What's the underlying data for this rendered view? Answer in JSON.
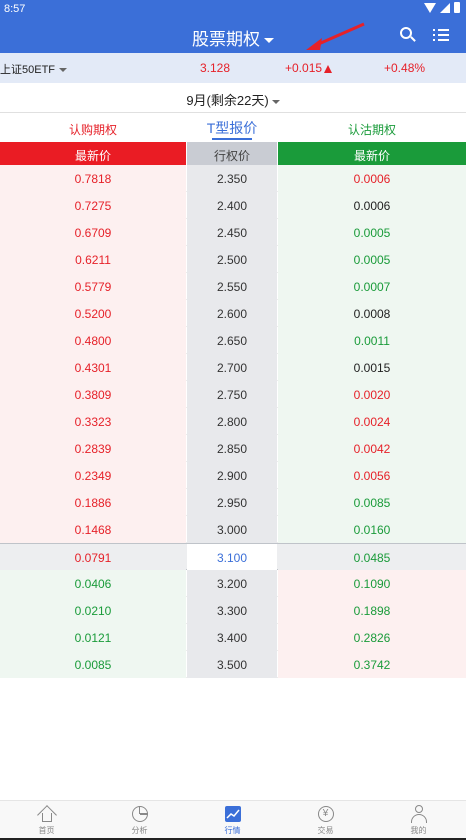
{
  "status_bar": {
    "time": "8:57"
  },
  "header": {
    "title": "股票期权"
  },
  "quote": {
    "symbol": "上证50ETF",
    "price": "3.128",
    "change": "+0.015",
    "change_pct": "+0.48%"
  },
  "expiry": {
    "label": "9月(剩余22天)"
  },
  "tabs": {
    "call": "认购期权",
    "t_quote": "T型报价",
    "put": "认沽期权"
  },
  "columns": {
    "call_last": "最新价",
    "strike": "行权价",
    "put_last": "最新价"
  },
  "rows": [
    {
      "call": "0.7818",
      "strike": "2.350",
      "put": "0.0006",
      "put_color": "red"
    },
    {
      "call": "0.7275",
      "strike": "2.400",
      "put": "0.0006",
      "put_color": "black"
    },
    {
      "call": "0.6709",
      "strike": "2.450",
      "put": "0.0005",
      "put_color": "green"
    },
    {
      "call": "0.6211",
      "strike": "2.500",
      "put": "0.0005",
      "put_color": "green"
    },
    {
      "call": "0.5779",
      "strike": "2.550",
      "put": "0.0007",
      "put_color": "green"
    },
    {
      "call": "0.5200",
      "strike": "2.600",
      "put": "0.0008",
      "put_color": "black"
    },
    {
      "call": "0.4800",
      "strike": "2.650",
      "put": "0.0011",
      "put_color": "green"
    },
    {
      "call": "0.4301",
      "strike": "2.700",
      "put": "0.0015",
      "put_color": "black"
    },
    {
      "call": "0.3809",
      "strike": "2.750",
      "put": "0.0020",
      "put_color": "red"
    },
    {
      "call": "0.3323",
      "strike": "2.800",
      "put": "0.0024",
      "put_color": "red"
    },
    {
      "call": "0.2839",
      "strike": "2.850",
      "put": "0.0042",
      "put_color": "red"
    },
    {
      "call": "0.2349",
      "strike": "2.900",
      "put": "0.0056",
      "put_color": "red"
    },
    {
      "call": "0.1886",
      "strike": "2.950",
      "put": "0.0085",
      "put_color": "green"
    },
    {
      "call": "0.1468",
      "strike": "3.000",
      "put": "0.0160",
      "put_color": "green"
    },
    {
      "call": "0.0791",
      "strike": "3.100",
      "put": "0.0485",
      "put_color": "green"
    },
    {
      "call": "0.0406",
      "strike": "3.200",
      "put": "0.1090",
      "put_color": "green"
    },
    {
      "call": "0.0210",
      "strike": "3.300",
      "put": "0.1898",
      "put_color": "green"
    },
    {
      "call": "0.0121",
      "strike": "3.400",
      "put": "0.2826",
      "put_color": "green"
    },
    {
      "call": "0.0085",
      "strike": "3.500",
      "put": "0.3742",
      "put_color": "green"
    }
  ],
  "row_colors": {
    "call_before_atm": "red",
    "call_after_atm": "green"
  },
  "atm_index": 14,
  "colors": {
    "brand_blue": "#3b6fd8",
    "up_red": "#e62129",
    "down_green": "#1a9b3a"
  },
  "bottom_nav": [
    {
      "label": "首页",
      "icon": "home-icon"
    },
    {
      "label": "分析",
      "icon": "pie-chart-icon"
    },
    {
      "label": "行情",
      "icon": "market-chart-icon",
      "active": true
    },
    {
      "label": "交易",
      "icon": "yen-icon"
    },
    {
      "label": "我的",
      "icon": "profile-icon"
    }
  ]
}
